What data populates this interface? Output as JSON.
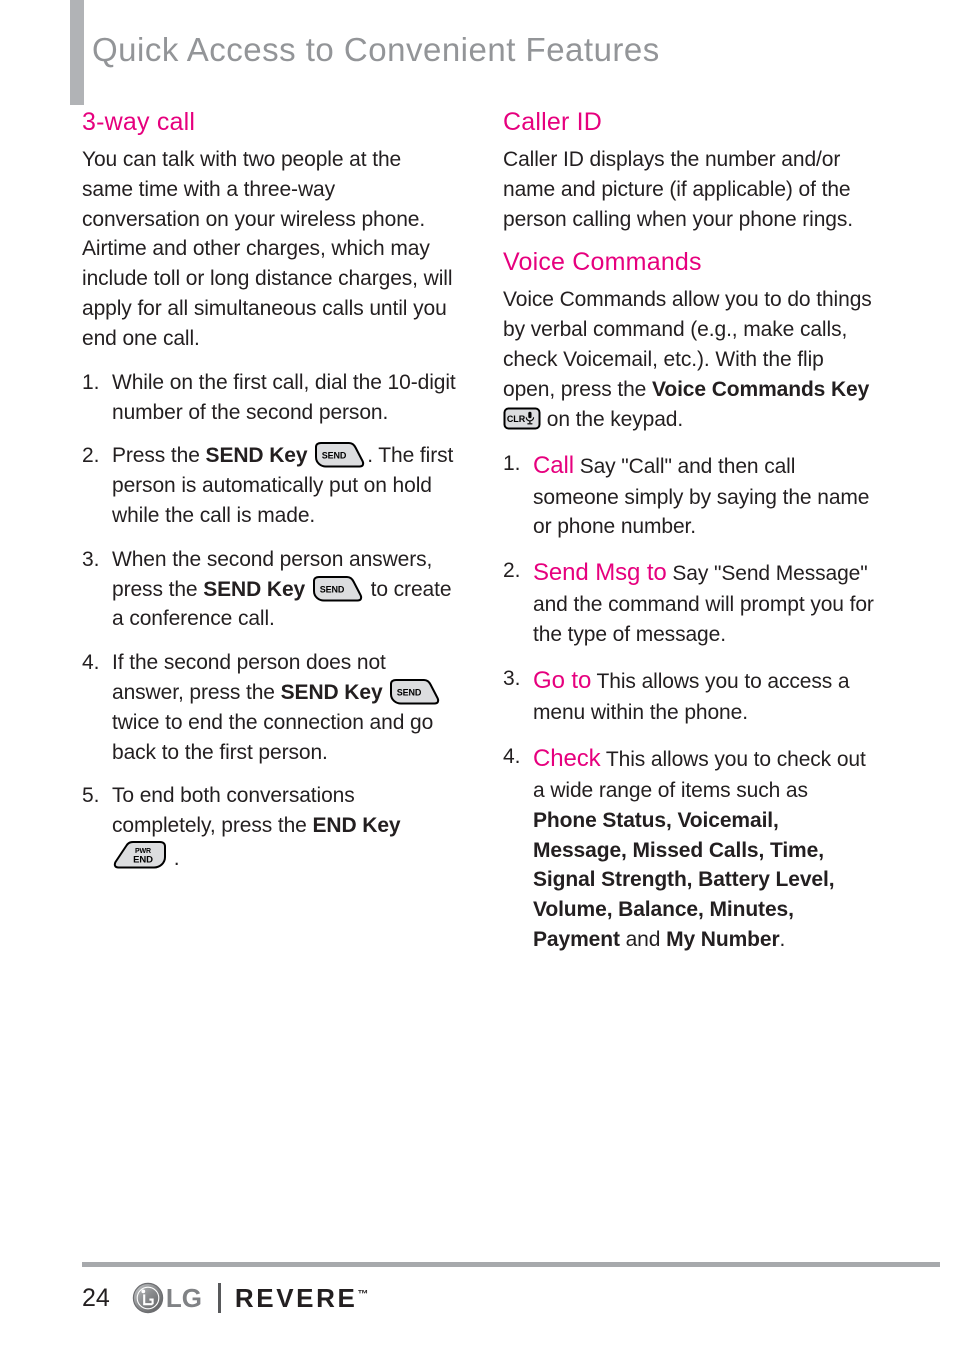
{
  "header": {
    "title": "Quick Access to Convenient Features"
  },
  "colors": {
    "accent_pink": "#e6007e",
    "header_gray": "#939598",
    "bar_gray": "#b1b3b6",
    "rule_gray": "#a7a9ac",
    "body_text": "#231f20"
  },
  "left_column": {
    "heading": "3-way call",
    "intro": "You can talk with two people at the same time with a three-way conversation on your wireless phone. Airtime and other charges, which may include toll or long distance charges, will apply for all simultaneous calls until you end one call.",
    "steps": [
      {
        "num": "1.",
        "part1": "While on the first call, dial the 10-digit number of the second person.",
        "bold1": "",
        "part2": "",
        "icon": "",
        "part3": ""
      },
      {
        "num": "2.",
        "part1": "Press the ",
        "bold1": "SEND Key",
        "part2": " ",
        "icon": "send-key-icon",
        "part3": ". The first person is automatically put on hold while the call is made."
      },
      {
        "num": "3.",
        "part1": "When the second person answers, press the ",
        "bold1": "SEND Key",
        "part2": " ",
        "icon": "send-key-icon",
        "part3": " to create a conference call."
      },
      {
        "num": "4.",
        "part1": "If the second person does not answer, press the ",
        "bold1": "SEND Key",
        "part2": " ",
        "icon": "send-key-icon",
        "part3": " twice to end the connection and go back to the first person."
      },
      {
        "num": "5.",
        "part1": "To end both conversations completely, press the ",
        "bold1": "END Key",
        "part2": " ",
        "icon": "end-key-icon",
        "part3": " ."
      }
    ]
  },
  "right_column": {
    "caller_id": {
      "heading": "Caller ID",
      "body": "Caller ID displays the number and/or name and picture (if applicable) of the person calling when your phone rings."
    },
    "voice_commands": {
      "heading": "Voice Commands",
      "intro_part1": "Voice Commands allow you to do things by verbal command (e.g., make calls, check Voicemail, etc.). With the flip open, press the ",
      "intro_bold": "Voice Commands Key",
      "intro_part2": " ",
      "intro_icon": "clr-voice-key-icon",
      "intro_part3": " on the keypad.",
      "steps": [
        {
          "num": "1.",
          "command": "Call",
          "text": " Say \"Call\" and then call someone simply by saying the name or phone number.",
          "bolds": []
        },
        {
          "num": "2.",
          "command": "Send Msg to",
          "text": " Say \"Send Message\" and the command will prompt you for the type of message.",
          "bolds": []
        },
        {
          "num": "3.",
          "command": "Go to",
          "text": " This allows you to access a menu within the phone.",
          "bolds": []
        },
        {
          "num": "4.",
          "command": "Check",
          "text_lead": " This allows you to check out a wide range of items such as ",
          "bold_list_1": "Phone Status, Voicemail, Message, Missed Calls, Time, Signal Strength, Battery Level, Volume, Balance, Minutes, Payment",
          "text_mid": " and ",
          "bold_list_2": "My Number",
          "text_tail": "."
        }
      ]
    }
  },
  "key_icons": {
    "send_label": "SEND",
    "end_label_top": "PWR",
    "end_label_bottom": "END",
    "clr_label": "CLR"
  },
  "footer": {
    "page_number": "24",
    "lg_word": "LG",
    "brand_name": "REVERE",
    "trademark": "™"
  }
}
